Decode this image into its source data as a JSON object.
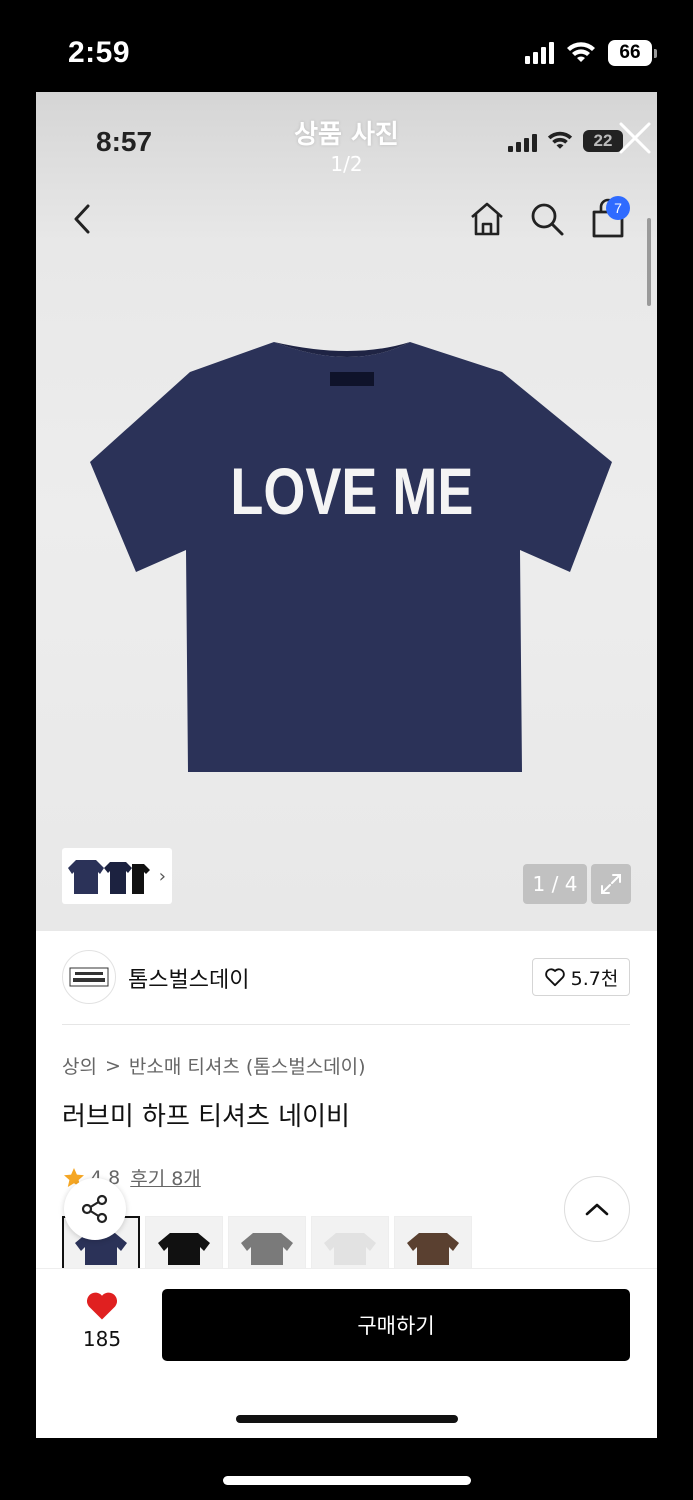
{
  "outer_status": {
    "time": "2:59",
    "battery": "66"
  },
  "inner_status": {
    "time": "8:57",
    "battery": "22"
  },
  "viewer": {
    "title": "상품 사진",
    "counter": "1/2"
  },
  "nav": {
    "cart_count": "7",
    "icons": [
      "back-icon",
      "home-icon",
      "search-icon",
      "cart-icon"
    ]
  },
  "product_image": {
    "print_text": "LOVE ME",
    "shirt_color": "#2b3258"
  },
  "gallery": {
    "image_counter": "1 / 4"
  },
  "brand": {
    "name": "톰스벌스데이",
    "likes": "5.7천"
  },
  "breadcrumb": {
    "category": "상의",
    "separator": ">",
    "subcategory": "반소매 티셔츠 (톰스벌스데이)"
  },
  "product": {
    "title": "러브미 하프 티셔츠 네이비",
    "rating": "4.8",
    "reviews": "후기 8개"
  },
  "colors": [
    "#2b3258",
    "#111111",
    "#7a7a7a",
    "#e2e2e2",
    "#5a4030"
  ],
  "bottom_bar": {
    "wish_count": "185",
    "buy_label": "구매하기"
  },
  "accent": {
    "badge": "#2f6bff",
    "heart": "#e02020",
    "star": "#f5a623"
  }
}
